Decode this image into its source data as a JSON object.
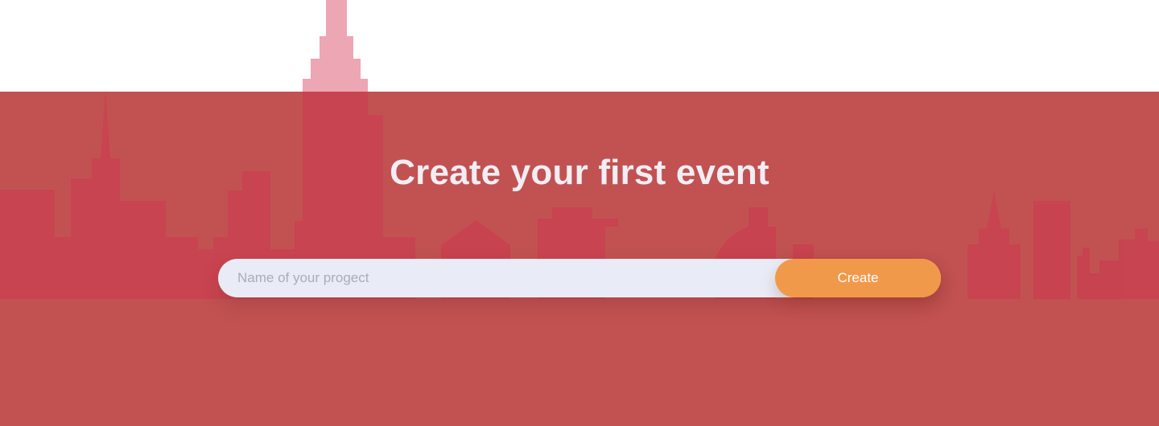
{
  "colors": {
    "page_background": "#ffffff",
    "hero_background": "#c25252",
    "skyline": "#c9404f",
    "tower_above_band": "#eda6b4",
    "title_text": "#f1eef4",
    "input_background": "#e9ecf6",
    "input_placeholder": "#a9adb9",
    "button_background": "#f1994a",
    "button_text": "#ffffff"
  },
  "hero": {
    "title": "Create your first event",
    "decoration": "city-skyline-illustration"
  },
  "form": {
    "project_name_placeholder": "Name of your progect",
    "project_name_value": "",
    "create_label": "Create"
  }
}
